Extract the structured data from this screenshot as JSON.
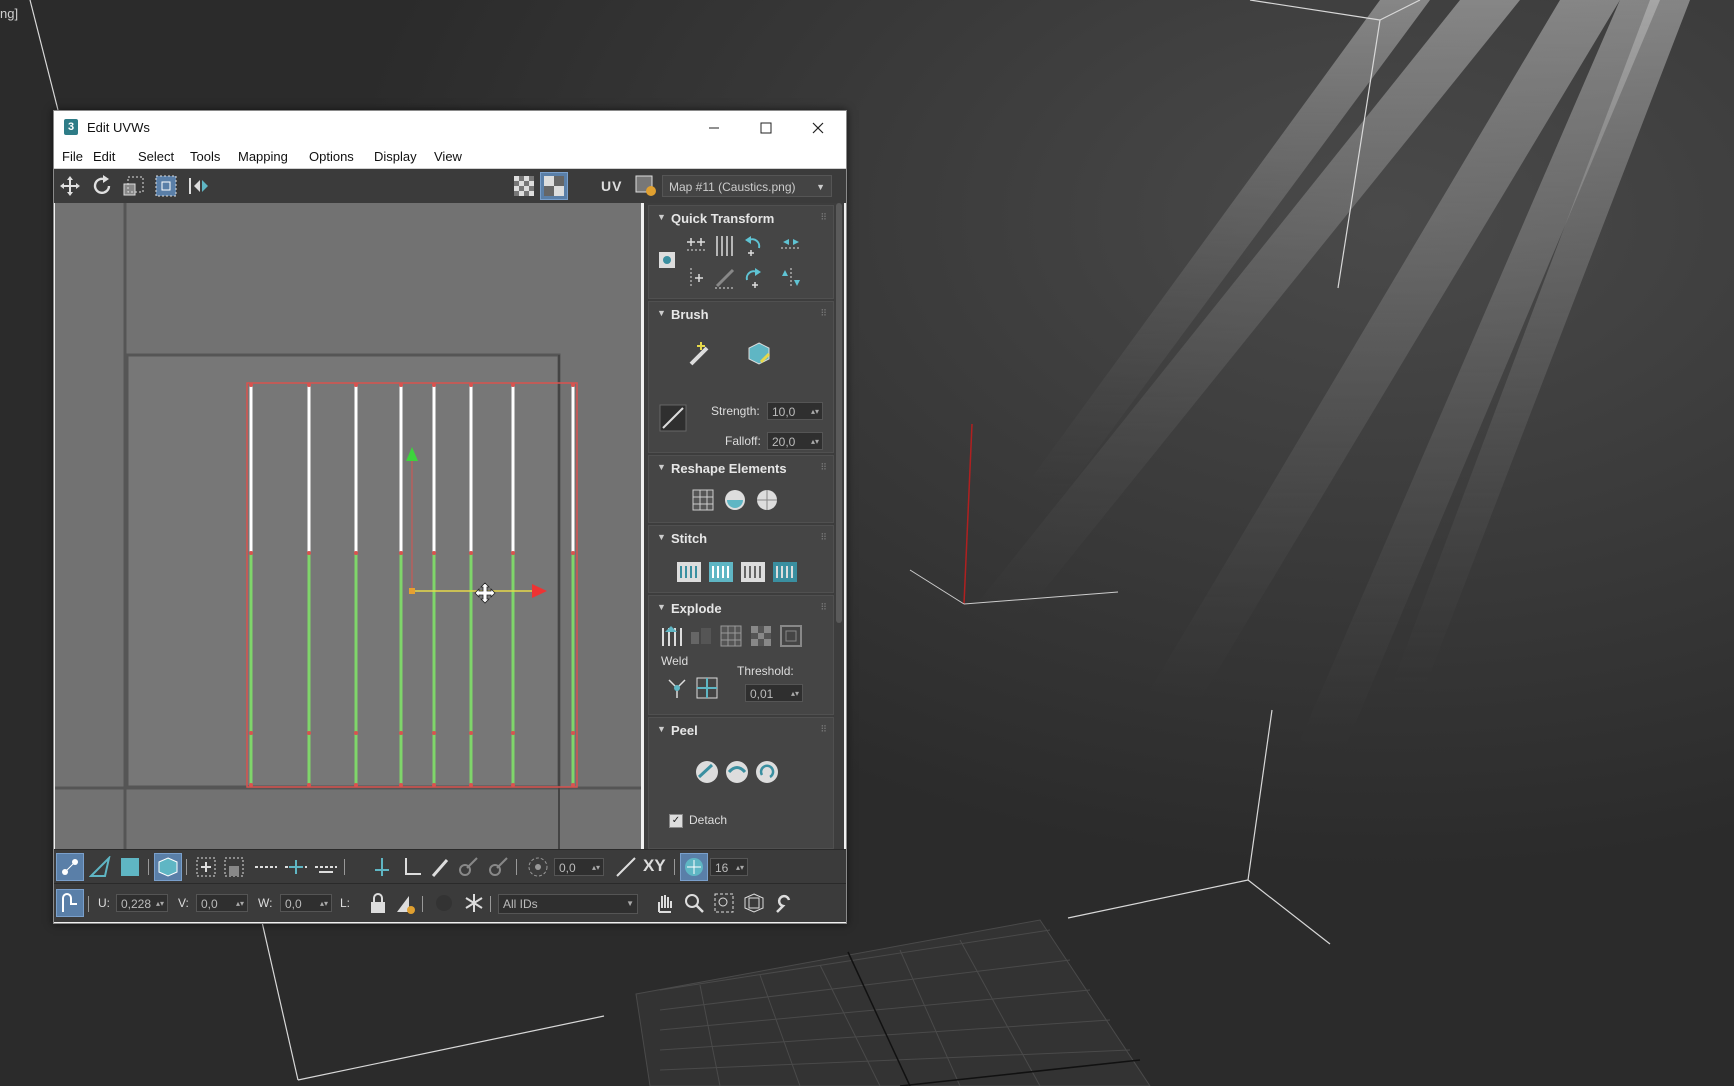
{
  "viewport": {
    "corner_text": "ng]"
  },
  "window": {
    "title": "Edit UVWs",
    "app_icon": "3"
  },
  "menu": [
    "File",
    "Edit",
    "Select",
    "Tools",
    "Mapping",
    "Options",
    "Display",
    "View"
  ],
  "toolbar_top": {
    "uv_label": "UV",
    "map_select": "Map #11 (Caustics.png)"
  },
  "panel": {
    "quick_transform": {
      "title": "Quick Transform"
    },
    "brush": {
      "title": "Brush",
      "strength_label": "Strength:",
      "strength_value": "10,0",
      "falloff_label": "Falloff:",
      "falloff_value": "20,0"
    },
    "reshape": {
      "title": "Reshape Elements"
    },
    "stitch": {
      "title": "Stitch"
    },
    "explode": {
      "title": "Explode",
      "weld_label": "Weld",
      "threshold_label": "Threshold:",
      "threshold_value": "0,01"
    },
    "peel": {
      "title": "Peel",
      "detach_label": "Detach"
    }
  },
  "bottom_toolbar": {
    "angle_value": "0,0",
    "xy_label": "XY",
    "count_value": "16",
    "u_label": "U:",
    "u_value": "0,228",
    "v_label": "V:",
    "v_value": "0,0",
    "w_label": "W:",
    "w_value": "0,0",
    "l_label": "L:",
    "ids_select": "All IDs"
  },
  "colors": {
    "viewport_bg": "#2b2b2b",
    "canvas_bg": "#727272",
    "panel_bg": "#3d3d3d",
    "selection_red": "#d9534f",
    "uv_green": "#7fd66a",
    "gizmo_yellow": "#e6d84a"
  }
}
